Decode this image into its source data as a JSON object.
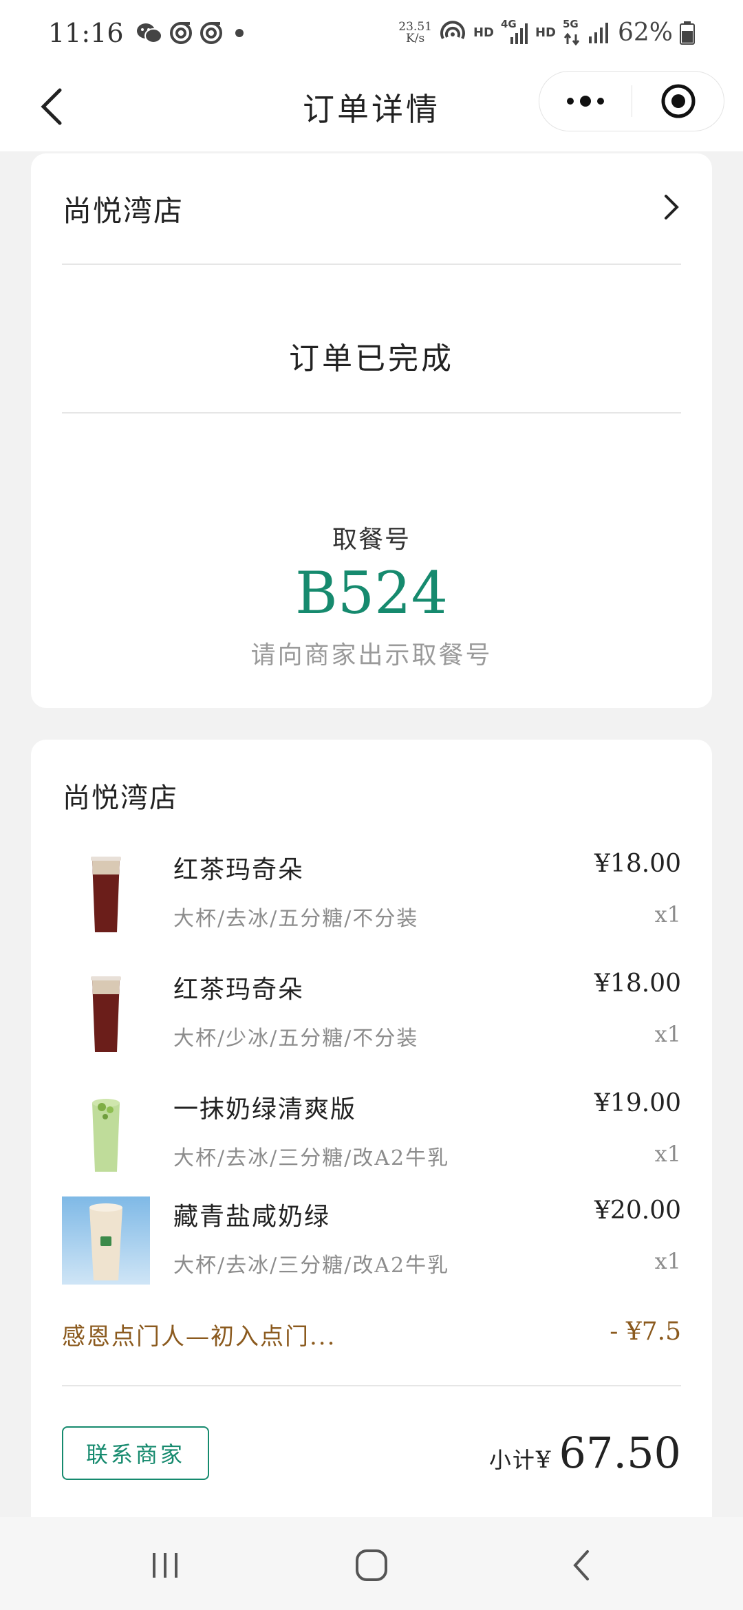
{
  "status_bar": {
    "time": "11:16",
    "net_speed_value": "23.51",
    "net_speed_unit": "K/s",
    "hd1": "HD",
    "sig1_type": "4G",
    "hd2": "HD",
    "sig2_type": "5G",
    "battery": "62%"
  },
  "nav": {
    "title": "订单详情"
  },
  "order_card": {
    "store_name": "尚悦湾店",
    "status": "订单已完成",
    "pickup_label": "取餐号",
    "pickup_number": "B524",
    "pickup_hint": "请向商家出示取餐号"
  },
  "items_card": {
    "store_name": "尚悦湾店",
    "items": [
      {
        "name": "红茶玛奇朵",
        "spec": "大杯/去冰/五分糖/不分装",
        "price": "¥18.00",
        "qty": "x1",
        "thumb": "tea-cup"
      },
      {
        "name": "红茶玛奇朵",
        "spec": "大杯/少冰/五分糖/不分装",
        "price": "¥18.00",
        "qty": "x1",
        "thumb": "tea-cup"
      },
      {
        "name": "一抹奶绿清爽版",
        "spec": "大杯/去冰/三分糖/改A2牛乳",
        "price": "¥19.00",
        "qty": "x1",
        "thumb": "green-milk-cup"
      },
      {
        "name": "藏青盐咸奶绿",
        "spec": "大杯/去冰/三分糖/改A2牛乳",
        "price": "¥20.00",
        "qty": "x1",
        "thumb": "salted-milk-cup"
      }
    ],
    "discount_name": "感恩点门人—初入点门...",
    "discount_amount": "- ¥7.5",
    "contact_button": "联系商家",
    "subtotal_label": "小计",
    "subtotal_currency": "¥",
    "subtotal_value": "67.50"
  },
  "colors": {
    "accent_green": "#168a6e",
    "discount_brown": "#8b5a1e",
    "background": "#f2f2f2"
  }
}
